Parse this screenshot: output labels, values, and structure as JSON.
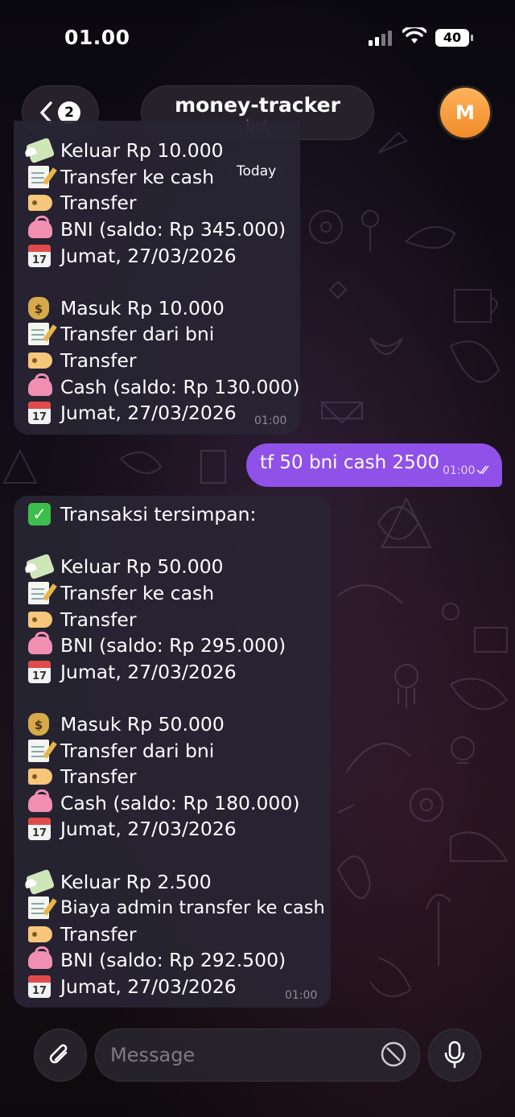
{
  "status_bar": {
    "time": "01.00",
    "battery": "40"
  },
  "header": {
    "back_badge": "2",
    "title": "money-tracker",
    "subtitle": "bot",
    "avatar_letter": "M"
  },
  "date_chip": "Today",
  "messages": [
    {
      "direction": "in",
      "lines": [
        {
          "icon": "flying-money-icon",
          "text": "Keluar Rp 10.000"
        },
        {
          "icon": "memo-icon",
          "text": "Transfer ke cash"
        },
        {
          "icon": "label-icon",
          "text": "Transfer"
        },
        {
          "icon": "purse-icon",
          "text": "BNI (saldo: Rp 345.000)"
        },
        {
          "icon": "calendar-icon",
          "text": "Jumat, 27/03/2026"
        },
        {
          "icon": "money-bag-icon",
          "text": "Masuk Rp 10.000"
        },
        {
          "icon": "memo-icon",
          "text": "Transfer dari bni"
        },
        {
          "icon": "label-icon",
          "text": "Transfer"
        },
        {
          "icon": "purse-icon",
          "text": "Cash (saldo: Rp 130.000)"
        },
        {
          "icon": "calendar-icon",
          "text": "Jumat, 27/03/2026"
        }
      ],
      "time": "01:00"
    },
    {
      "direction": "out",
      "text": "tf 50 bni cash 2500",
      "time": "01:00",
      "status": "read"
    },
    {
      "direction": "in",
      "lines": [
        {
          "icon": "check-mark-icon",
          "text": "Transaksi tersimpan:"
        },
        {
          "icon": "flying-money-icon",
          "text": "Keluar Rp 50.000"
        },
        {
          "icon": "memo-icon",
          "text": "Transfer ke cash"
        },
        {
          "icon": "label-icon",
          "text": "Transfer"
        },
        {
          "icon": "purse-icon",
          "text": "BNI (saldo: Rp 295.000)"
        },
        {
          "icon": "calendar-icon",
          "text": "Jumat, 27/03/2026"
        },
        {
          "icon": "money-bag-icon",
          "text": "Masuk Rp 50.000"
        },
        {
          "icon": "memo-icon",
          "text": "Transfer dari bni"
        },
        {
          "icon": "label-icon",
          "text": "Transfer"
        },
        {
          "icon": "purse-icon",
          "text": "Cash (saldo: Rp 180.000)"
        },
        {
          "icon": "calendar-icon",
          "text": "Jumat, 27/03/2026"
        },
        {
          "icon": "flying-money-icon",
          "text": "Keluar Rp 2.500"
        },
        {
          "icon": "memo-icon",
          "text": "Biaya admin transfer ke cash"
        },
        {
          "icon": "label-icon",
          "text": "Transfer"
        },
        {
          "icon": "purse-icon",
          "text": "BNI (saldo: Rp 292.500)"
        },
        {
          "icon": "calendar-icon",
          "text": "Jumat, 27/03/2026"
        }
      ],
      "time": "01:00"
    }
  ],
  "composer": {
    "placeholder": "Message"
  },
  "colors": {
    "accent": "#8f51e8",
    "avatar": "#f39b3c",
    "bubble_in": "#28253a"
  }
}
